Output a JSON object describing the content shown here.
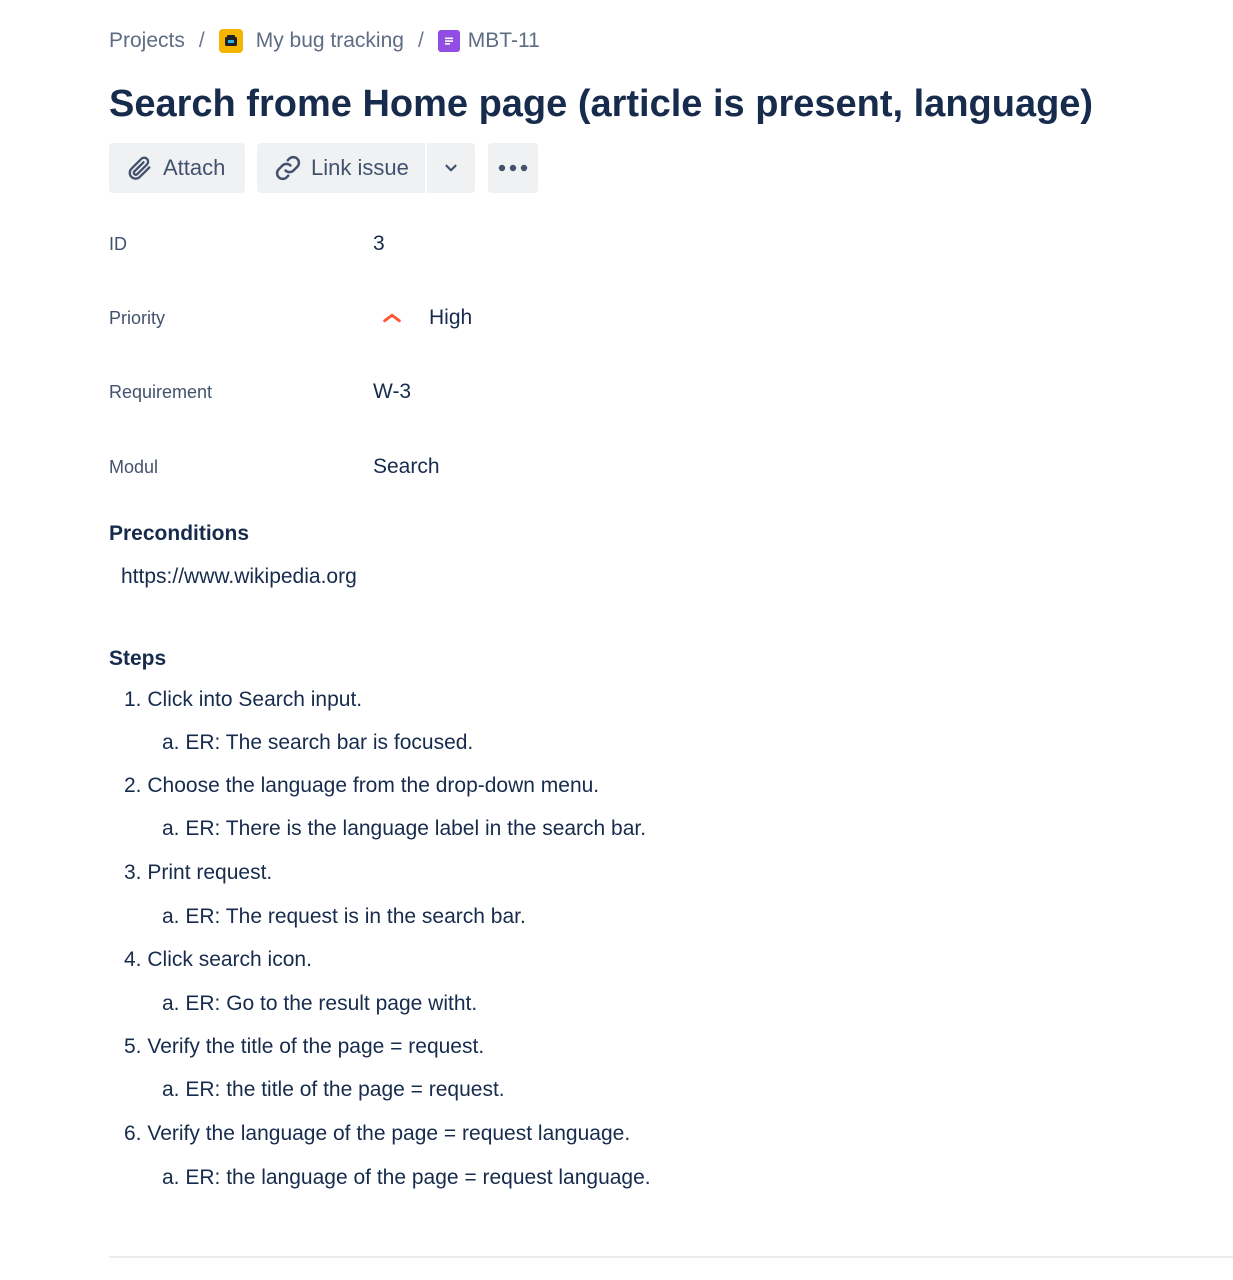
{
  "breadcrumb": {
    "projects": "Projects",
    "project_name": "My bug tracking",
    "issue_key": "MBT-11",
    "separator": "/"
  },
  "issue": {
    "title": "Search frome Home page (article is present, language)"
  },
  "toolbar": {
    "attach_label": "Attach",
    "link_issue_label": "Link issue",
    "more_label": "•••"
  },
  "fields": {
    "id": {
      "label": "ID",
      "value": "3"
    },
    "priority": {
      "label": "Priority",
      "value": "High",
      "color": "#ff5630"
    },
    "requirement": {
      "label": "Requirement",
      "value": "W-3"
    },
    "modul": {
      "label": "Modul",
      "value": "Search"
    }
  },
  "preconditions": {
    "heading": "Preconditions",
    "text": "https://www.wikipedia.org"
  },
  "steps": {
    "heading": "Steps",
    "items": [
      {
        "num": "1.",
        "text": "Click into Search input.",
        "sub": "a. ER: The search bar is focused."
      },
      {
        "num": "2.",
        "text": "Choose the language from the drop-down menu.",
        "sub": "a. ER: There is the language label in the search bar."
      },
      {
        "num": "3.",
        "text": "Print request.",
        "sub": "a. ER: The request is in the search bar."
      },
      {
        "num": "4.",
        "text": "Click search icon.",
        "sub": "a. ER: Go to the result page witht."
      },
      {
        "num": "5.",
        "text": "Verify the title of the page = request.",
        "sub": "a. ER: the title of the page = request."
      },
      {
        "num": "6.",
        "text": "Verify the language of the page = request language.",
        "sub": "a. ER: the language of the page = request language."
      }
    ]
  },
  "icons": {
    "project": "project-avatar-icon",
    "issue_type": "story-icon",
    "attach": "paperclip-icon",
    "link": "link-icon",
    "dropdown": "chevron-down-icon",
    "priority": "priority-high-icon"
  }
}
